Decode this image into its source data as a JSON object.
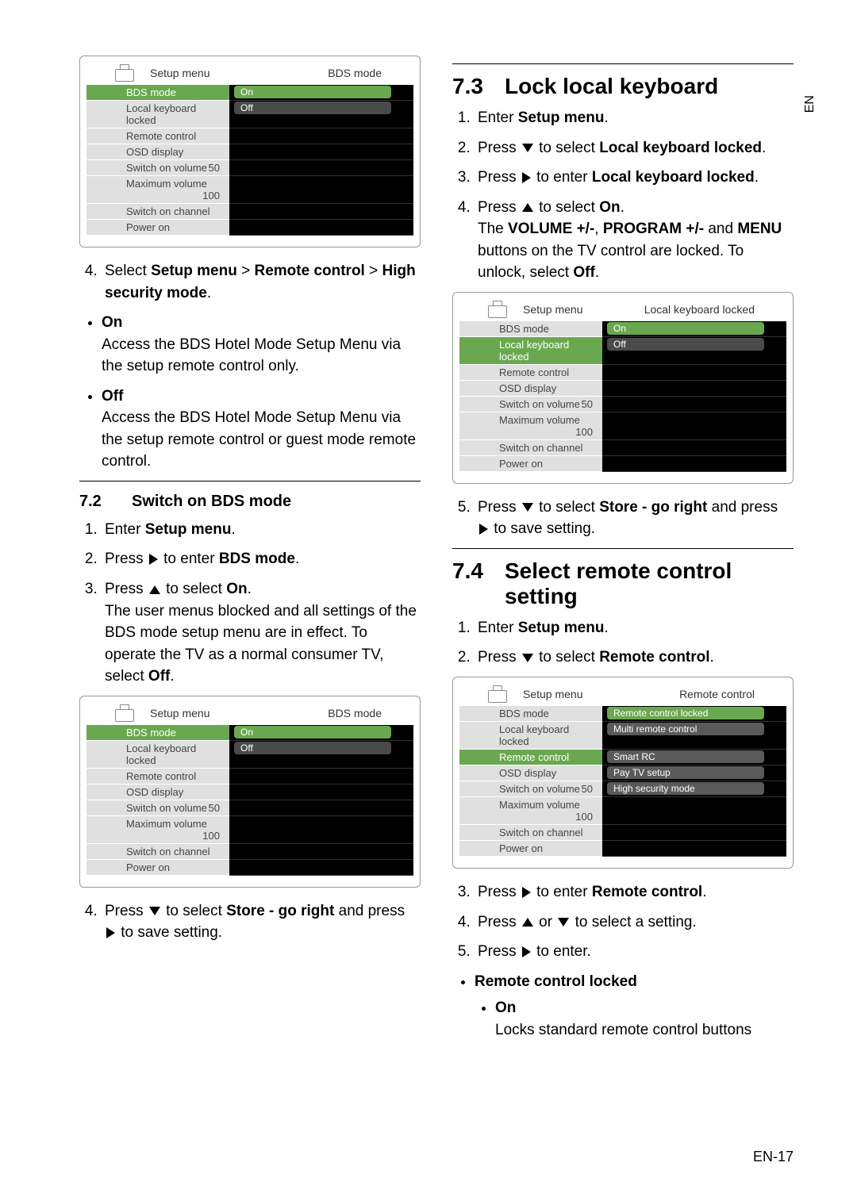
{
  "sideTab": "EN",
  "pageNum": "EN-17",
  "menuCommon": {
    "title": "Setup menu",
    "items": [
      {
        "label": "BDS mode",
        "val": ""
      },
      {
        "label": "Local keyboard locked",
        "val": ""
      },
      {
        "label": "Remote control",
        "val": ""
      },
      {
        "label": "OSD display",
        "val": ""
      },
      {
        "label": "Switch on volume",
        "val": "50"
      },
      {
        "label": "Maximum volume",
        "val": "100"
      },
      {
        "label": "Switch on channel",
        "val": ""
      },
      {
        "label": "Power on",
        "val": ""
      }
    ]
  },
  "figure1": {
    "subtitle": "BDS mode",
    "opts": [
      "On",
      "Off"
    ],
    "sel": 0,
    "leftSel": 0
  },
  "figure2": {
    "subtitle": "BDS mode",
    "opts": [
      "On",
      "Off"
    ],
    "sel": 0,
    "leftSel": 0
  },
  "figure3": {
    "subtitle": "Local keyboard locked",
    "opts": [
      "On",
      "Off"
    ],
    "sel": 0,
    "leftSel": 1
  },
  "figure4": {
    "subtitle": "Remote control",
    "opts": [
      "Remote control locked",
      "Multi remote control",
      "Smart RC",
      "Pay TV setup",
      "High security mode"
    ],
    "sel": 0,
    "leftSel": 2
  },
  "leftCol": {
    "step4": {
      "prefix": "Select ",
      "b1": "Setup menu",
      "gt1": " > ",
      "b2": "Remote control",
      "gt2": " > ",
      "b3": "High security mode",
      "suffix": "."
    },
    "onTitle": "On",
    "onText": "Access the BDS Hotel Mode Setup Menu via the setup remote control only.",
    "offTitle": "Off",
    "offText": "Access the BDS Hotel Mode Setup Menu via the setup remote control or guest mode remote control.",
    "h72num": "7.2",
    "h72title": "Switch on BDS mode",
    "s72_1a": "Enter ",
    "s72_1b": "Setup menu",
    "s72_1c": ".",
    "s72_2a": "Press ",
    "s72_2b": " to enter ",
    "s72_2c": "BDS mode",
    "s72_2d": ".",
    "s72_3a": "Press ",
    "s72_3b": " to select ",
    "s72_3c": "On",
    "s72_3d": ".",
    "s72_3text": "The user menus blocked and all settings of the BDS mode setup menu are in effect. To operate the TV as a normal consumer TV, select ",
    "s72_3off": "Off",
    "s72_3end": ".",
    "s72_4a": "Press ",
    "s72_4b": " to select ",
    "s72_4c": "Store - go right",
    "s72_4d": " and press ",
    "s72_4e": " to save setting."
  },
  "rightCol": {
    "h73num": "7.3",
    "h73title": "Lock local keyboard",
    "s73_1a": "Enter ",
    "s73_1b": "Setup menu",
    "s73_1c": ".",
    "s73_2a": "Press ",
    "s73_2b": " to select ",
    "s73_2c": "Local keyboard locked",
    "s73_2d": ".",
    "s73_3a": "Press ",
    "s73_3b": " to enter ",
    "s73_3c": "Local keyboard locked",
    "s73_3d": ".",
    "s73_4a": "Press ",
    "s73_4b": " to select ",
    "s73_4c": "On",
    "s73_4d": ".",
    "s73_4text1": "The ",
    "s73_4b1": "VOLUME +/-",
    "s73_4text2": ", ",
    "s73_4b2": "PROGRAM +/-",
    "s73_4text3": " and ",
    "s73_4b3": "MENU",
    "s73_4text4": " buttons on the TV control are locked. To unlock, select ",
    "s73_4b4": "Off",
    "s73_4text5": ".",
    "s73_5a": "Press ",
    "s73_5b": " to select ",
    "s73_5c": "Store - go right",
    "s73_5d": " and press ",
    "s73_5e": " to save setting.",
    "h74num": "7.4",
    "h74title": "Select remote control setting",
    "s74_1a": "Enter ",
    "s74_1b": "Setup menu",
    "s74_1c": ".",
    "s74_2a": "Press ",
    "s74_2b": " to select ",
    "s74_2c": "Remote control",
    "s74_2d": ".",
    "s74_3a": "Press ",
    "s74_3b": " to enter ",
    "s74_3c": "Remote control",
    "s74_3d": ".",
    "s74_4a": "Press ",
    "s74_4b": " or ",
    "s74_4c": " to select a setting.",
    "s74_5a": "Press ",
    "s74_5b": " to enter.",
    "rcl": "Remote control locked",
    "rclOn": "On",
    "rclOnText": "Locks standard remote control buttons"
  }
}
